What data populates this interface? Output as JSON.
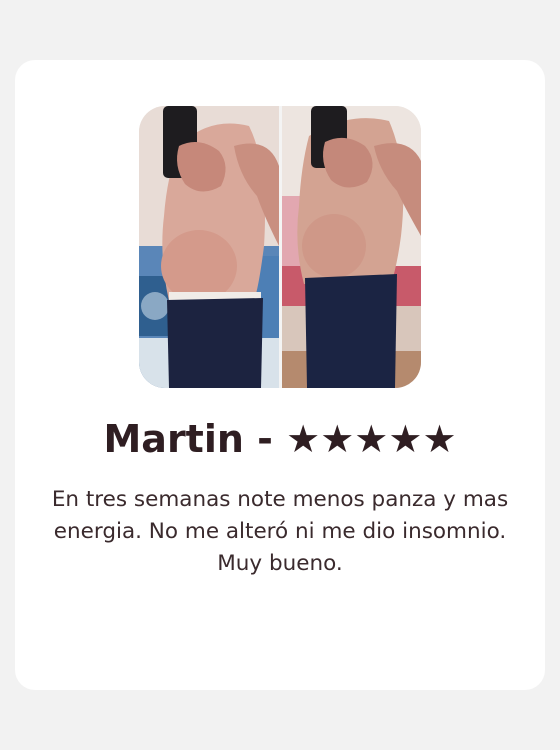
{
  "review": {
    "name": "Martin -",
    "stars": "★★★★★",
    "rating": 5,
    "text": "En tres semanas note menos panza y mas energia. No me alteró ni me dio insomnio. Muy bueno."
  },
  "colors": {
    "page_background": "#f2f2f2",
    "card_background": "#ffffff",
    "name_text": "#2f1e22",
    "body_text": "#3a2a2d"
  }
}
